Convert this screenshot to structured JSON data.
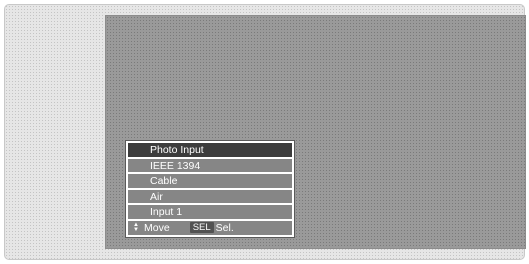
{
  "menu": {
    "items": [
      {
        "label": "Photo Input",
        "selected": true
      },
      {
        "label": "IEEE 1394",
        "selected": false
      },
      {
        "label": "Cable",
        "selected": false
      },
      {
        "label": "Air",
        "selected": false
      },
      {
        "label": "Input 1",
        "selected": false
      }
    ],
    "footer": {
      "move_icon": "updown-arrow-icon",
      "move_label": "Move",
      "sel_key": "SEL",
      "sel_label": "Sel."
    }
  }
}
